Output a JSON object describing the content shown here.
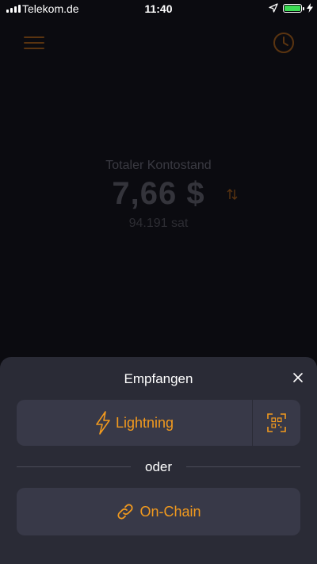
{
  "status_bar": {
    "carrier": "Telekom.de",
    "time": "11:40"
  },
  "main": {
    "balance_label": "Totaler Kontostand",
    "balance_value": "7,66 $",
    "balance_sat": "94.191 sat"
  },
  "sheet": {
    "title": "Empfangen",
    "lightning_label": "Lightning",
    "or_text": "oder",
    "onchain_label": "On-Chain"
  },
  "colors": {
    "accent": "#f29a1e",
    "sheet_bg": "#2a2b36",
    "button_bg": "#383948",
    "background": "#0b0b10"
  },
  "icons": [
    "signal-icon",
    "location-icon",
    "battery-icon",
    "charging-icon",
    "menu-icon",
    "clock-icon",
    "swap-icon",
    "close-icon",
    "lightning-icon",
    "qr-scan-icon",
    "chain-link-icon"
  ]
}
